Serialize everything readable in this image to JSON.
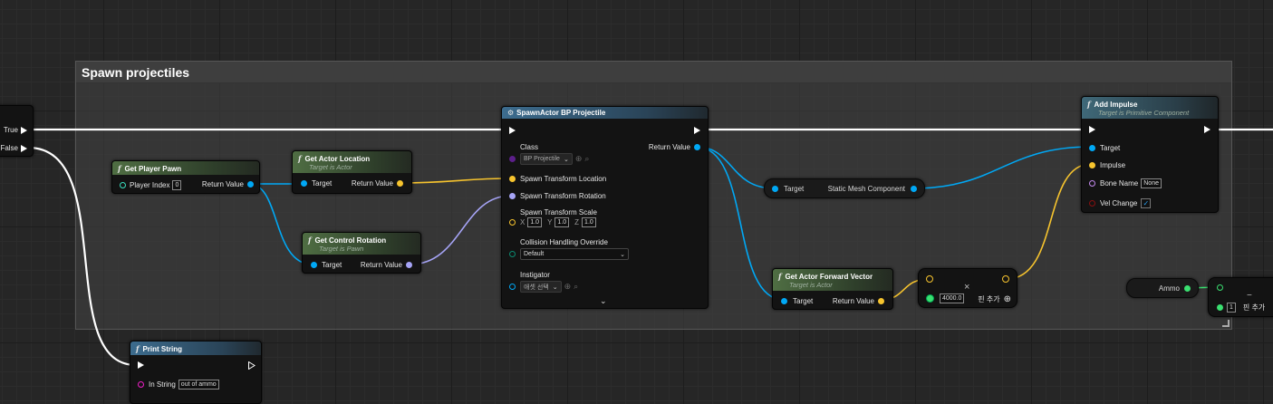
{
  "comment_box": {
    "title": "Spawn projectiles"
  },
  "branch": {
    "true_label": "True",
    "false_label": "False"
  },
  "get_player_pawn": {
    "title": "Get Player Pawn",
    "player_index_label": "Player Index",
    "player_index_value": "0",
    "return_label": "Return Value"
  },
  "get_actor_location": {
    "title": "Get Actor Location",
    "subtitle": "Target is Actor",
    "target_label": "Target",
    "return_label": "Return Value"
  },
  "get_control_rotation": {
    "title": "Get Control Rotation",
    "subtitle": "Target is Pawn",
    "target_label": "Target",
    "return_label": "Return Value"
  },
  "spawn_actor": {
    "title": "SpawnActor BP Projectile",
    "class_label": "Class",
    "class_value": "BP Projectile",
    "return_label": "Return Value",
    "location_label": "Spawn Transform Location",
    "rotation_label": "Spawn Transform Rotation",
    "scale_label": "Spawn Transform Scale",
    "scale_x_label": "X",
    "scale_x": "1.0",
    "scale_y_label": "Y",
    "scale_y": "1.0",
    "scale_z_label": "Z",
    "scale_z": "1.0",
    "collision_label": "Collision Handling Override",
    "collision_value": "Default",
    "instigator_label": "Instigator",
    "instigator_value": "애셋 선택"
  },
  "static_mesh": {
    "target_label": "Target",
    "output_label": "Static Mesh Component"
  },
  "get_forward_vector": {
    "title": "Get Actor Forward Vector",
    "subtitle": "Target is Actor",
    "target_label": "Target",
    "return_label": "Return Value"
  },
  "multiply": {
    "value": "4000.0",
    "add_pin_label": "핀 추가"
  },
  "add_impulse": {
    "title": "Add Impulse",
    "subtitle": "Target is Primitive Component",
    "target_label": "Target",
    "impulse_label": "Impulse",
    "bone_label": "Bone Name",
    "bone_value": "None",
    "vel_change_label": "Vel Change"
  },
  "ammo": {
    "label": "Ammo"
  },
  "subtract": {
    "value": "1",
    "add_pin_label": "핀 추가"
  },
  "print_string": {
    "title": "Print String",
    "in_string_label": "In String",
    "in_string_value": "out of ammo"
  },
  "colors": {
    "exec": "#ffffff",
    "object": "#00a8f5",
    "vector": "#f7c42e",
    "rotator": "#a6a4f6",
    "float": "#3ae070"
  }
}
